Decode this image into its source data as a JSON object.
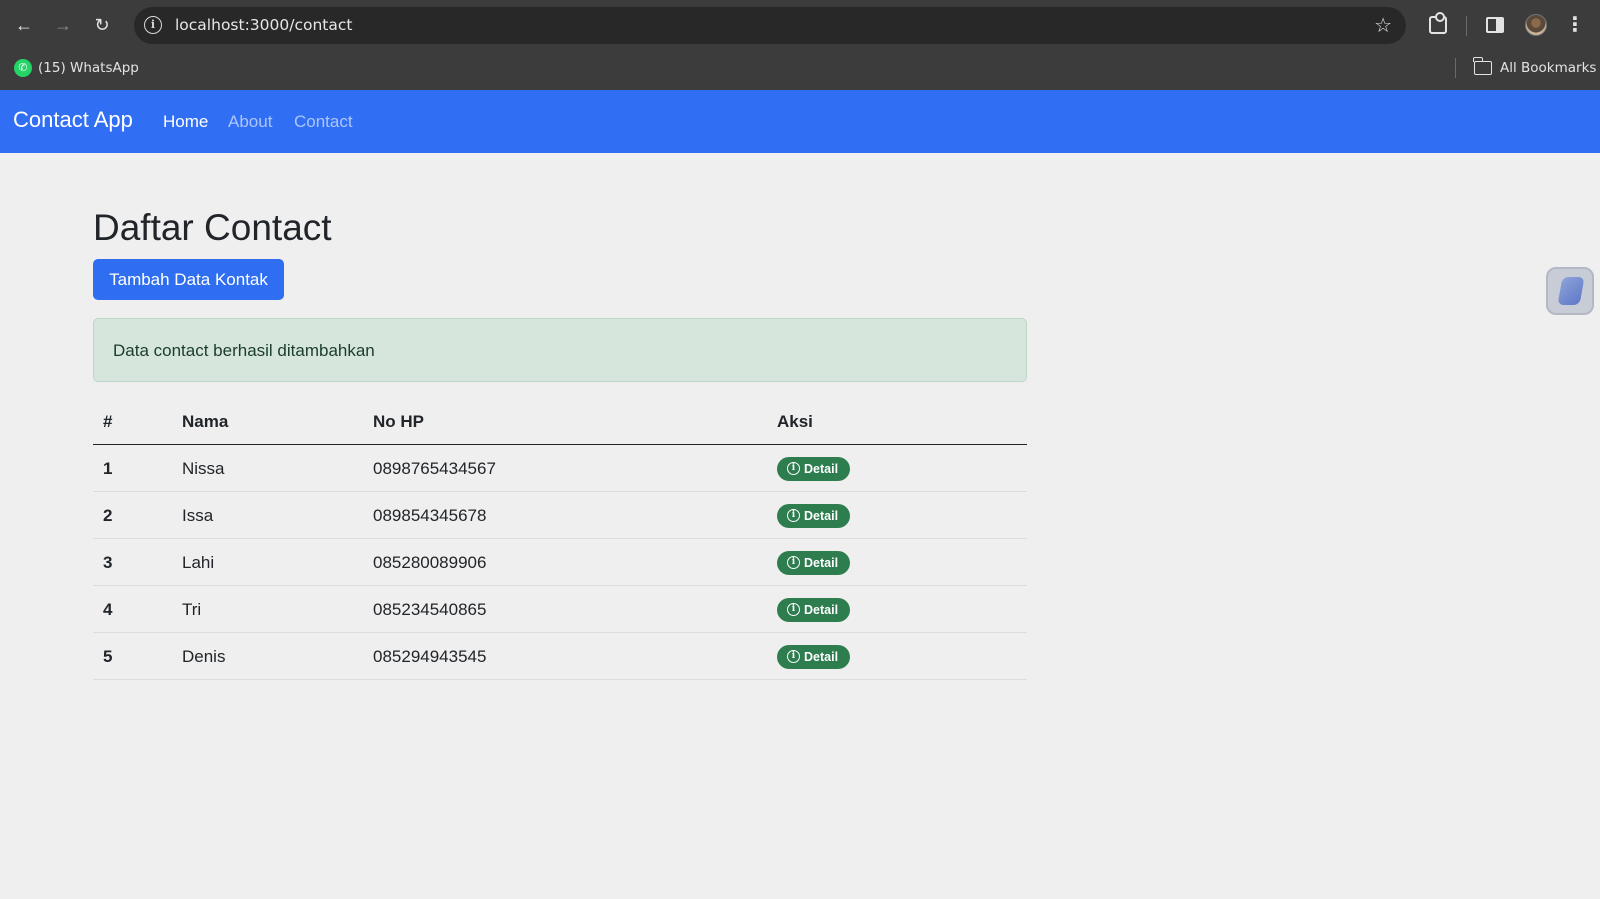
{
  "browser": {
    "url": "localhost:3000/contact",
    "bookmarks": [
      {
        "label": "(15) WhatsApp"
      }
    ],
    "all_bookmarks_label": "All Bookmarks"
  },
  "navbar": {
    "brand": "Contact App",
    "links": [
      {
        "label": "Home",
        "active": true
      },
      {
        "label": "About",
        "active": false
      },
      {
        "label": "Contact",
        "active": false
      }
    ]
  },
  "page": {
    "title": "Daftar Contact",
    "add_button": "Tambah Data Kontak",
    "alert": "Data contact berhasil ditambahkan"
  },
  "table": {
    "headers": [
      "#",
      "Nama",
      "No HP",
      "Aksi"
    ],
    "rows": [
      {
        "num": "1",
        "nama": "Nissa",
        "hp": "0898765434567",
        "action": "Detail"
      },
      {
        "num": "2",
        "nama": "Issa",
        "hp": "089854345678",
        "action": "Detail"
      },
      {
        "num": "3",
        "nama": "Lahi",
        "hp": "085280089906",
        "action": "Detail"
      },
      {
        "num": "4",
        "nama": "Tri",
        "hp": "085234540865",
        "action": "Detail"
      },
      {
        "num": "5",
        "nama": "Denis",
        "hp": "085294943545",
        "action": "Detail"
      }
    ]
  },
  "colors": {
    "navbar_bg": "#306ef4",
    "button_bg": "#2f6ef0",
    "alert_bg": "#d7e6dd",
    "badge_bg": "#2e7d4f",
    "page_bg": "#efefef"
  }
}
